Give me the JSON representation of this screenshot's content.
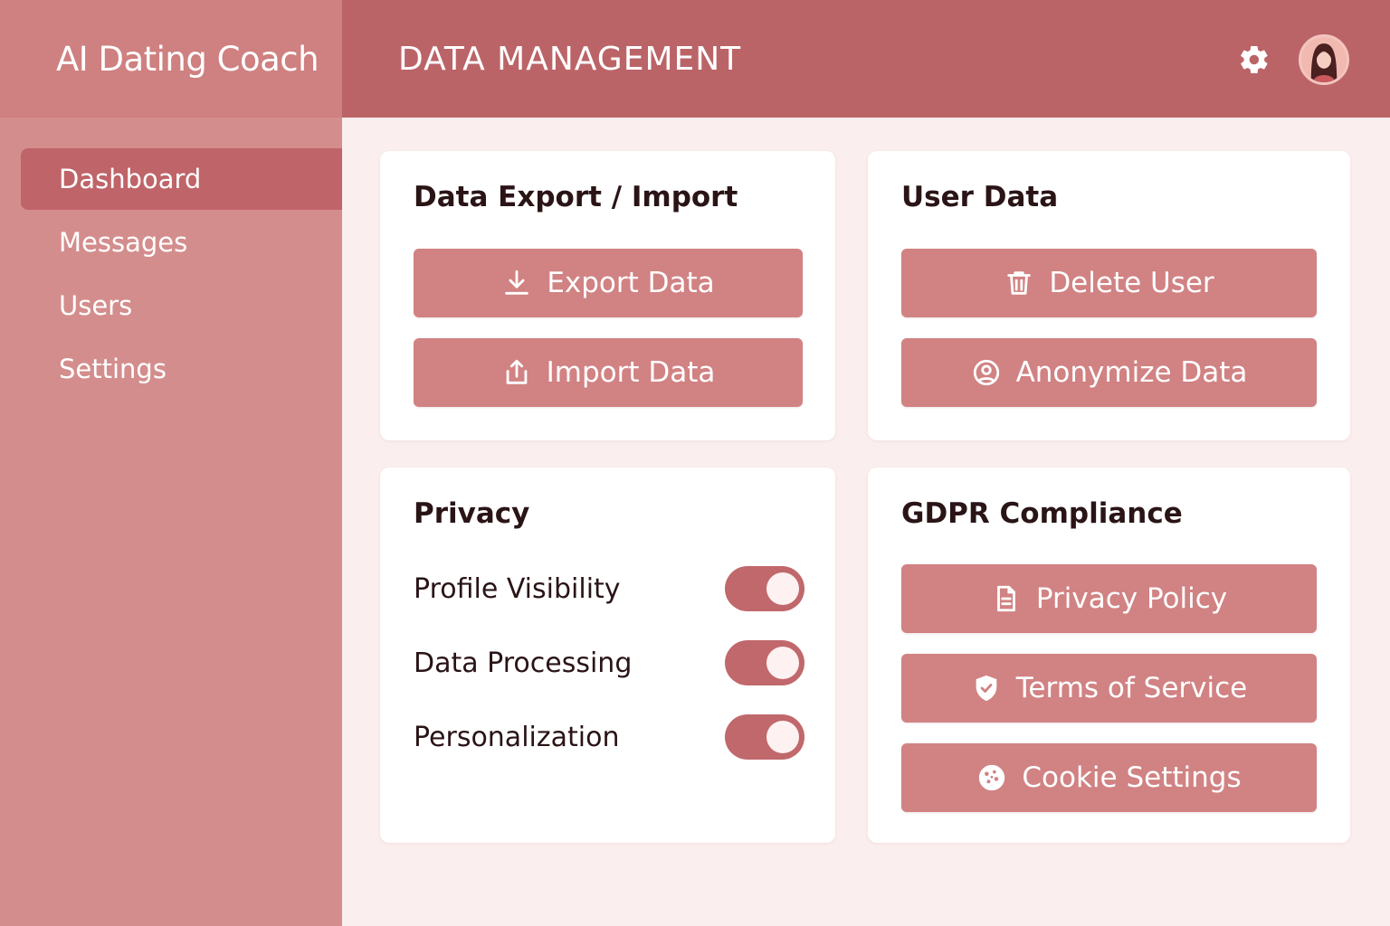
{
  "app": {
    "title": "AI Dating Coach"
  },
  "header": {
    "title": "DATA MANAGEMENT",
    "settings_icon": "gear-icon",
    "avatar_icon": "user-avatar"
  },
  "sidebar": {
    "items": [
      {
        "label": "Dashboard",
        "active": true
      },
      {
        "label": "Messages",
        "active": false
      },
      {
        "label": "Users",
        "active": false
      },
      {
        "label": "Settings",
        "active": false
      }
    ]
  },
  "cards": {
    "export_import": {
      "title": "Data Export / Import",
      "export_label": "Export Data",
      "export_icon": "download-icon",
      "import_label": "Import Data",
      "import_icon": "upload-icon"
    },
    "user_data": {
      "title": "User Data",
      "delete_label": "Delete User",
      "delete_icon": "trash-icon",
      "anonymize_label": "Anonymize Data",
      "anonymize_icon": "user-circle-icon"
    },
    "privacy": {
      "title": "Privacy",
      "toggles": [
        {
          "label": "Profile Visibility",
          "on": true
        },
        {
          "label": "Data Processing",
          "on": true
        },
        {
          "label": "Personalization",
          "on": true
        }
      ]
    },
    "gdpr": {
      "title": "GDPR Compliance",
      "privacy_policy_label": "Privacy Policy",
      "privacy_policy_icon": "document-icon",
      "terms_label": "Terms of Service",
      "terms_icon": "shield-check-icon",
      "cookie_label": "Cookie Settings",
      "cookie_icon": "cookie-icon"
    }
  },
  "colors": {
    "sidebar": "#d48d8d",
    "header": "#bb6468",
    "active_nav": "#bf6468",
    "button": "#d18283",
    "toggle_on": "#c0686b",
    "background": "#fbeeee"
  }
}
